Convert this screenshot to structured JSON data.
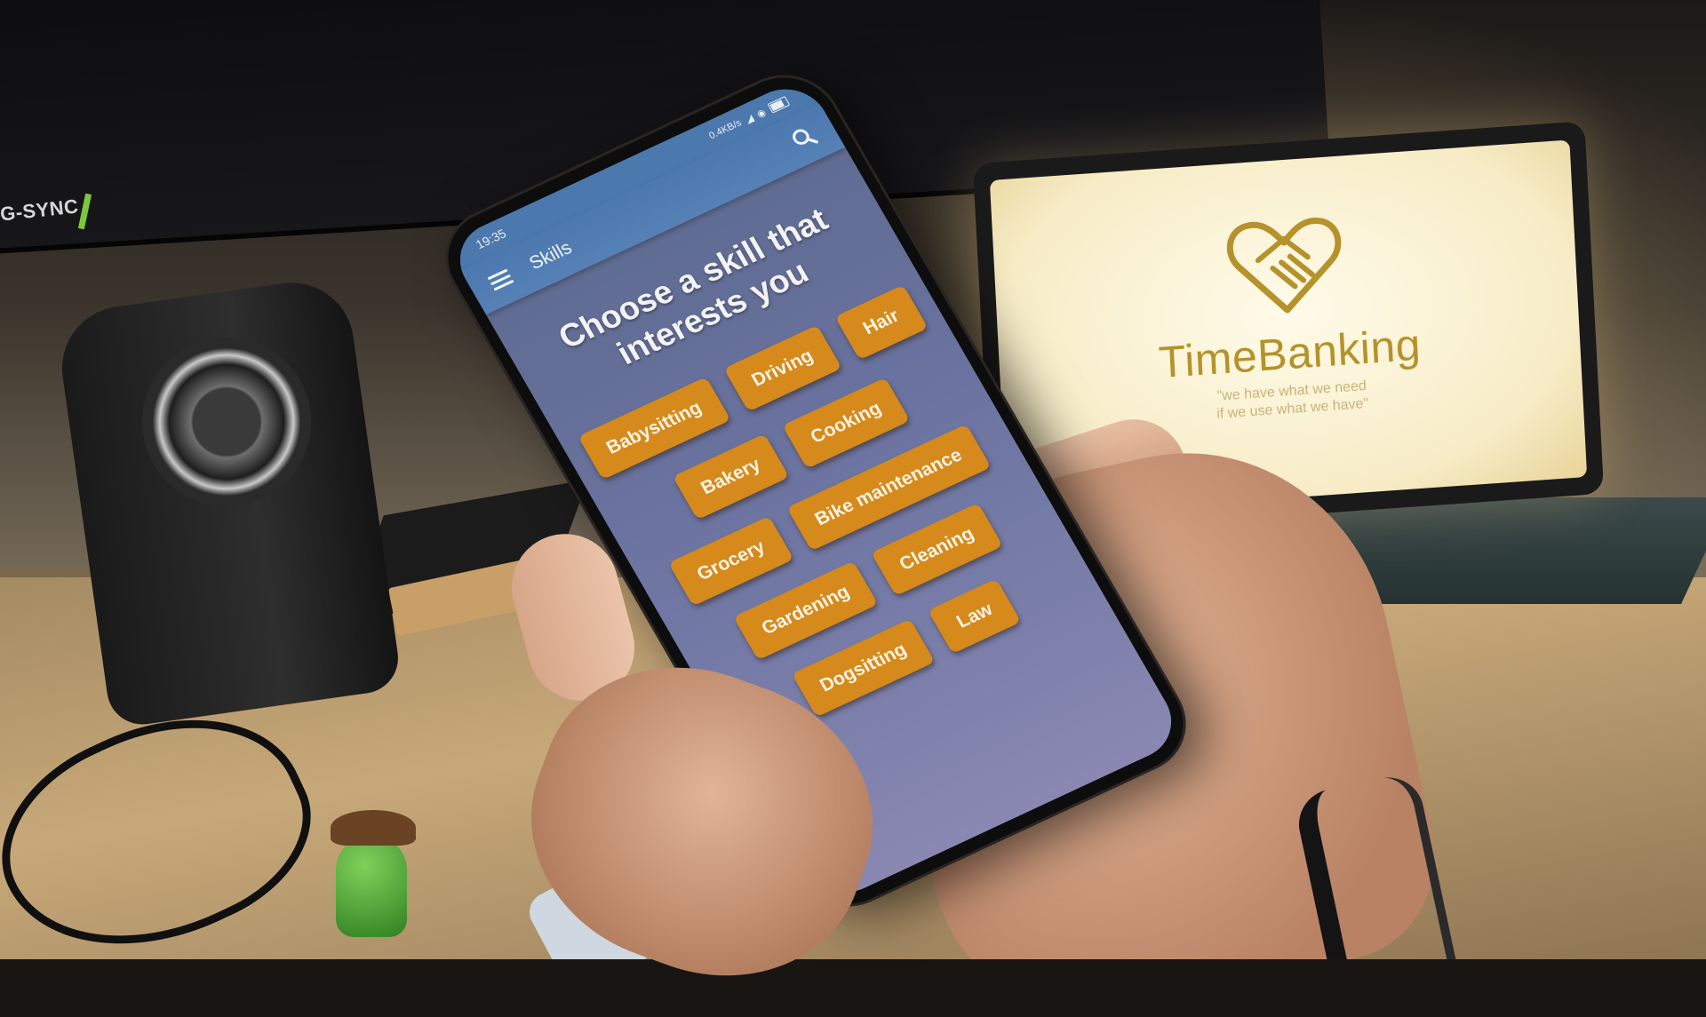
{
  "phone": {
    "status": {
      "time": "19:35",
      "net_speed": "0.4KB/s"
    },
    "appbar": {
      "title": "Skills"
    },
    "headline": "Choose a skill that interests you",
    "skills": [
      "Babysitting",
      "Driving",
      "Hair",
      "Bakery",
      "Cooking",
      "Grocery",
      "Bike maintenance",
      "Gardening",
      "Cleaning",
      "Dogsitting",
      "Law"
    ],
    "icons": [
      "menu-icon",
      "search-icon"
    ],
    "colors": {
      "appbar": "#4b78ad",
      "chip": "#d58a1b",
      "background": "#6b73a0"
    }
  },
  "tablet": {
    "brand": "TimeBanking",
    "tagline_line1": "\"we have what we need",
    "tagline_line2": "if we use what we have\""
  },
  "monitor": {
    "label": "G-SYNC"
  }
}
